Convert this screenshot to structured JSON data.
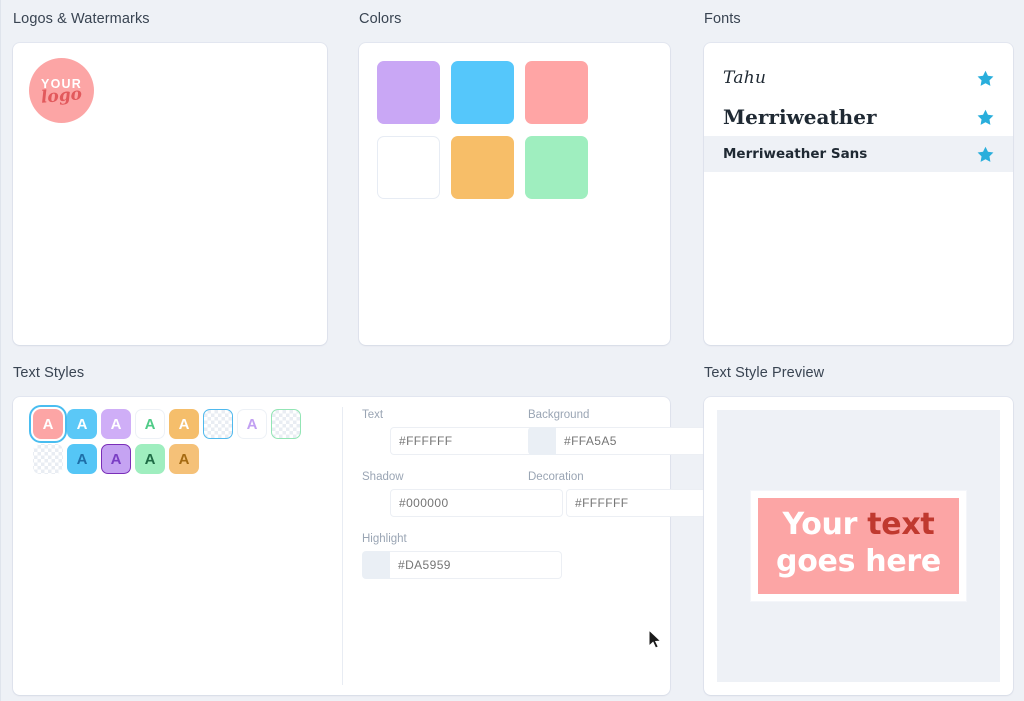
{
  "sections": {
    "logos": {
      "title": "Logos & Watermarks"
    },
    "colors": {
      "title": "Colors"
    },
    "fonts": {
      "title": "Fonts"
    },
    "text_styles": {
      "title": "Text Styles"
    },
    "preview": {
      "title": "Text Style Preview"
    }
  },
  "logo": {
    "circle_color": "#FCA5A5",
    "line1": "YOUR",
    "line2": "logo",
    "line2_color": "#E2595C"
  },
  "colors": {
    "swatches": [
      {
        "name": "purple",
        "hex": "#C9A7F5",
        "empty": false
      },
      {
        "name": "blue",
        "hex": "#55C7FB",
        "empty": false
      },
      {
        "name": "coral",
        "hex": "#FFA5A5",
        "empty": false
      },
      {
        "name": "add",
        "hex": "#FFFFFF",
        "empty": true
      },
      {
        "name": "orange",
        "hex": "#F7BE68",
        "empty": false
      },
      {
        "name": "green",
        "hex": "#9FEEBF",
        "empty": false
      }
    ]
  },
  "fonts": {
    "items": [
      {
        "name": "Tahu",
        "favorited": true,
        "active": false
      },
      {
        "name": "Merriweather",
        "favorited": true,
        "active": false
      },
      {
        "name": "Merriweather Sans",
        "favorited": true,
        "active": true
      }
    ],
    "star_color": "#29AEDC"
  },
  "text_styles": {
    "swatches": [
      {
        "id": "s1",
        "letter": "A",
        "bg": "#FCA5A5",
        "fg": "#FFFFFF",
        "selected": true,
        "checker": false,
        "border": ""
      },
      {
        "id": "s2",
        "letter": "A",
        "bg": "#5BC8F7",
        "fg": "#FFFFFF",
        "selected": false,
        "checker": false,
        "border": ""
      },
      {
        "id": "s3",
        "letter": "A",
        "bg": "#CFAEF7",
        "fg": "#FFFFFF",
        "selected": false,
        "checker": false,
        "border": ""
      },
      {
        "id": "s4",
        "letter": "A",
        "bg": "#FFFFFF",
        "fg": "#4FCB87",
        "selected": false,
        "checker": false,
        "border": "#EDF1F6"
      },
      {
        "id": "s5",
        "letter": "A",
        "bg": "#F5BE6B",
        "fg": "#FFFFFF",
        "selected": false,
        "checker": false,
        "border": ""
      },
      {
        "id": "s6",
        "letter": "",
        "bg": "",
        "fg": "",
        "selected": false,
        "checker": true,
        "border": "#4FB9EE"
      },
      {
        "id": "s7",
        "letter": "A",
        "bg": "#FFFFFF",
        "fg": "#C2A0F2",
        "selected": false,
        "checker": false,
        "border": "#EDF1F6"
      },
      {
        "id": "s8",
        "letter": "",
        "bg": "",
        "fg": "",
        "selected": false,
        "checker": true,
        "border": "#93E5B5"
      },
      {
        "id": "s9",
        "letter": "",
        "bg": "",
        "fg": "",
        "selected": false,
        "checker": true,
        "border": ""
      },
      {
        "id": "s10",
        "letter": "A",
        "bg": "#55C6F6",
        "fg": "#1E6FA8",
        "selected": false,
        "checker": false,
        "border": ""
      },
      {
        "id": "s11",
        "letter": "A",
        "bg": "#C5A3F2",
        "fg": "#7A3EC4",
        "selected": false,
        "checker": false,
        "border": "#7A2EB8"
      },
      {
        "id": "s12",
        "letter": "A",
        "bg": "#9FEEBF",
        "fg": "#1E6B45",
        "selected": false,
        "checker": false,
        "border": ""
      },
      {
        "id": "s13",
        "letter": "A",
        "bg": "#F5C178",
        "fg": "#A56A12",
        "selected": false,
        "checker": false,
        "border": ""
      }
    ],
    "fields": {
      "text": {
        "label": "Text",
        "value": "#FFFFFF",
        "swatch": null
      },
      "background": {
        "label": "Background",
        "value": "#FFA5A5",
        "swatch": "#EAEFF5"
      },
      "shadow": {
        "label": "Shadow",
        "value": "#000000",
        "swatch": null
      },
      "decoration": {
        "label": "Decoration",
        "value": "#FFFFFF",
        "swatch": null
      },
      "highlight": {
        "label": "Highlight",
        "value": "#DA5959",
        "swatch": "#EAEFF5"
      }
    }
  },
  "preview": {
    "line1_a": "Your ",
    "line1_b": "text",
    "line2": "goes here",
    "bg": "#FCA5A5",
    "text_color": "#FFFFFF",
    "highlight_color": "#C0392F"
  }
}
